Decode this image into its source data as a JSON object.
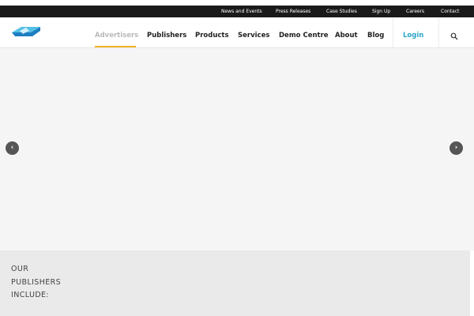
{
  "topbar": {
    "links": [
      "News and Events",
      "Press Releases",
      "Case Studies",
      "Sign Up",
      "Careers",
      "Contact"
    ]
  },
  "nav": {
    "items": [
      "Advertisers",
      "Publishers",
      "Products",
      "Services",
      "Demo Centre",
      "About",
      "Blog"
    ],
    "active": "Advertisers",
    "login": "Login",
    "accent": "#f0b323",
    "login_color": "#2aa5c7"
  },
  "slider": {
    "prev_icon": "chevron-left-icon",
    "next_icon": "chevron-right-icon",
    "prev_glyph": "‹",
    "next_glyph": "›"
  },
  "publishers_section": {
    "heading_lines": [
      "OUR",
      "PUBLISHERS",
      "INCLUDE:"
    ]
  }
}
